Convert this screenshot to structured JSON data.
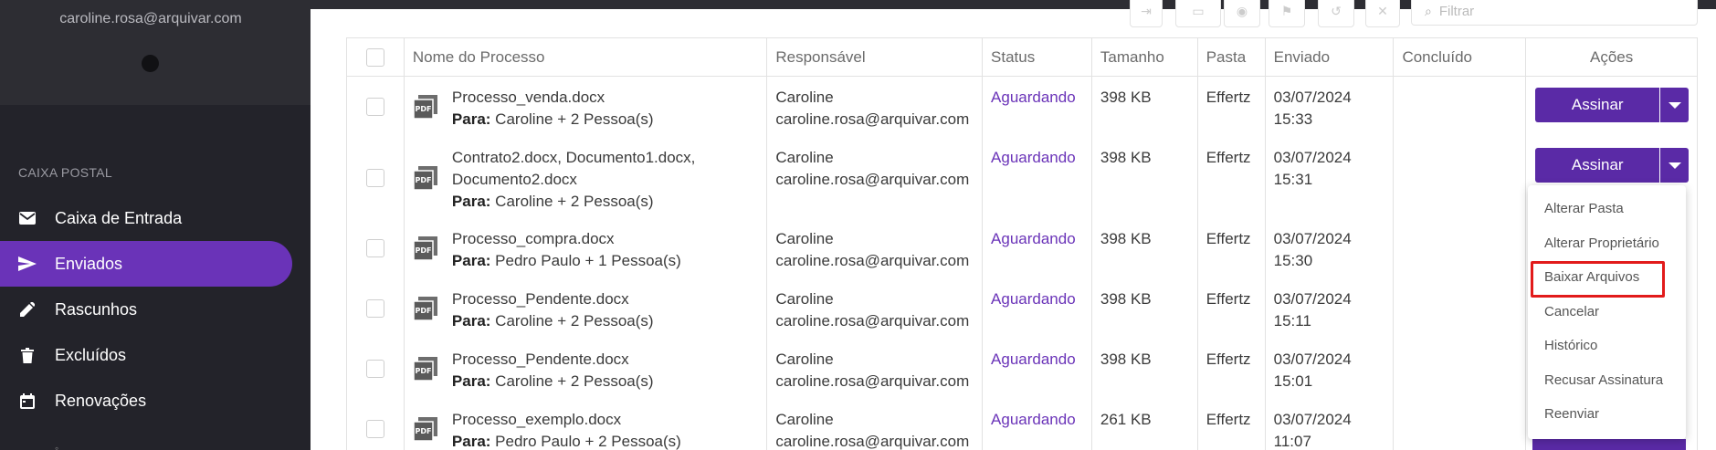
{
  "sidebar": {
    "user_email": "caroline.rosa@arquivar.com",
    "section_label": "CAIXA POSTAL",
    "items": [
      {
        "label": "Caixa de Entrada",
        "icon": "mail-icon",
        "active": false
      },
      {
        "label": "Enviados",
        "icon": "send-icon",
        "active": true
      },
      {
        "label": "Rascunhos",
        "icon": "pencil-icon",
        "active": false
      },
      {
        "label": "Excluídos",
        "icon": "trash-icon",
        "active": false
      },
      {
        "label": "Renovações",
        "icon": "calendar-icon",
        "active": false
      }
    ]
  },
  "toolbar": {
    "filter_placeholder": "Filtrar"
  },
  "table": {
    "headers": {
      "name": "Nome do Processo",
      "responsible": "Responsável",
      "status": "Status",
      "size": "Tamanho",
      "folder": "Pasta",
      "sent": "Enviado",
      "completed": "Concluído",
      "actions": "Ações"
    },
    "to_label": "Para:",
    "rows": [
      {
        "file": "Processo_venda.docx",
        "to": "Caroline + 2 Pessoa(s)",
        "resp_name": "Caroline",
        "resp_email": "caroline.rosa@arquivar.com",
        "status": "Aguardando",
        "size": "398 KB",
        "folder": "Effertz",
        "sent_date": "03/07/2024",
        "sent_time": "15:33",
        "completed": "",
        "action": "Assinar"
      },
      {
        "file": "Contrato2.docx, Documento1.docx, Documento2.docx",
        "to": "Caroline + 2 Pessoa(s)",
        "resp_name": "Caroline",
        "resp_email": "caroline.rosa@arquivar.com",
        "status": "Aguardando",
        "size": "398 KB",
        "folder": "Effertz",
        "sent_date": "03/07/2024",
        "sent_time": "15:31",
        "completed": "",
        "action": "Assinar"
      },
      {
        "file": "Processo_compra.docx",
        "to": "Pedro Paulo + 1 Pessoa(s)",
        "resp_name": "Caroline",
        "resp_email": "caroline.rosa@arquivar.com",
        "status": "Aguardando",
        "size": "398 KB",
        "folder": "Effertz",
        "sent_date": "03/07/2024",
        "sent_time": "15:30",
        "completed": "",
        "action": ""
      },
      {
        "file": "Processo_Pendente.docx",
        "to": "Caroline + 2 Pessoa(s)",
        "resp_name": "Caroline",
        "resp_email": "caroline.rosa@arquivar.com",
        "status": "Aguardando",
        "size": "398 KB",
        "folder": "Effertz",
        "sent_date": "03/07/2024",
        "sent_time": "15:11",
        "completed": "",
        "action": ""
      },
      {
        "file": "Processo_Pendente.docx",
        "to": "Caroline + 2 Pessoa(s)",
        "resp_name": "Caroline",
        "resp_email": "caroline.rosa@arquivar.com",
        "status": "Aguardando",
        "size": "398 KB",
        "folder": "Effertz",
        "sent_date": "03/07/2024",
        "sent_time": "15:01",
        "completed": "",
        "action": ""
      },
      {
        "file": "Processo_exemplo.docx",
        "to": "Pedro Paulo + 2 Pessoa(s)",
        "resp_name": "Caroline",
        "resp_email": "caroline.rosa@arquivar.com",
        "status": "Aguardando",
        "size": "261 KB",
        "folder": "Effertz",
        "sent_date": "03/07/2024",
        "sent_time": "11:07",
        "completed": "",
        "action": ""
      }
    ]
  },
  "action_menu": {
    "items": [
      "Alterar Pasta",
      "Alterar Proprietário",
      "Baixar Arquivos",
      "Cancelar",
      "Histórico",
      "Recusar Assinatura",
      "Reenviar"
    ],
    "highlighted": "Baixar Arquivos"
  },
  "colors": {
    "accent": "#6a33b8",
    "button": "#5a2aa6",
    "sidebar_bg": "#23232a",
    "highlight_border": "#e21b1b"
  }
}
